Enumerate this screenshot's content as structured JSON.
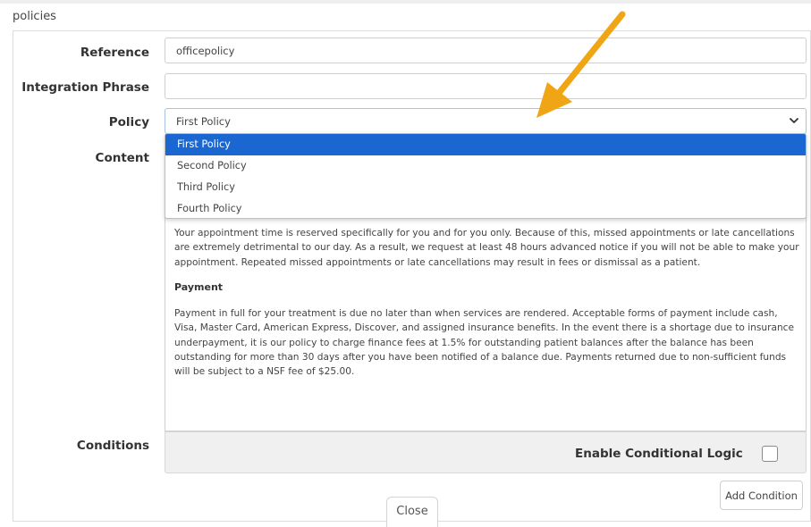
{
  "page": {
    "title": "policies"
  },
  "form": {
    "reference": {
      "label": "Reference",
      "value": "officepolicy"
    },
    "integration_phrase": {
      "label": "Integration Phrase",
      "value": ""
    },
    "policy": {
      "label": "Policy",
      "selected": "First Policy",
      "options": [
        "First Policy",
        "Second Policy",
        "Third Policy",
        "Fourth Policy"
      ]
    },
    "content": {
      "label": "Content",
      "paragraph1": "Your appointment time is reserved specifically for you and for you only. Because of this, missed appointments or late cancellations are extremely detrimental to our day. As a result, we request at least 48 hours advanced notice if you will not be able to make your appointment. Repeated missed appointments or late cancellations may result in fees or dismissal as a patient.",
      "heading2": "Payment",
      "paragraph2": "Payment in full for your treatment is due no later than when services are rendered. Acceptable forms of payment include cash, Visa, Master Card, American Express, Discover, and assigned insurance benefits. In the event there is a shortage due to insurance underpayment, it is our policy to charge finance fees at 1.5% for outstanding patient balances after the balance has been outstanding for more than 30 days after you have been notified of a balance due. Payments returned due to non-sufficient funds will be subject to a NSF fee of $25.00."
    },
    "conditions": {
      "label": "Conditions",
      "enable_label": "Enable Conditional Logic",
      "enabled": false,
      "add_button": "Add Condition"
    }
  },
  "footer": {
    "close_label": "Close"
  },
  "colors": {
    "accent": "#1a67d2",
    "arrow": "#f0a515"
  }
}
